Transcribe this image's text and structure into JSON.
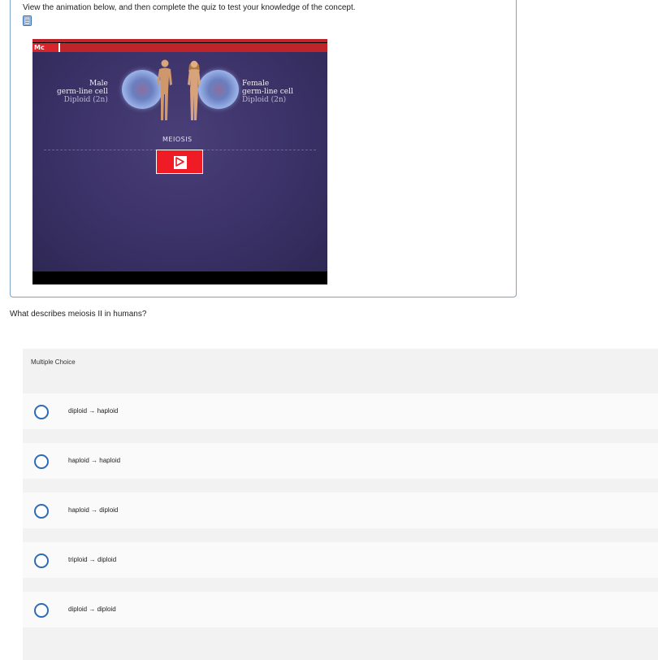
{
  "instruction": "View the animation below, and then complete the quiz to test your knowledge of the concept.",
  "video": {
    "logo_text": "Mc",
    "male_label": {
      "line1": "Male",
      "line2": "germ-line cell",
      "line3": "Diploid (2n)"
    },
    "female_label": {
      "line1": "Female",
      "line2": "germ-line cell",
      "line3": "Diploid (2n)"
    },
    "title": "MEIOSIS",
    "colors": {
      "brand_red": "#c0242b",
      "play_red": "#ef1c25",
      "frame": "#3b3268"
    }
  },
  "question": "What describes meiosis II in humans?",
  "multiple_choice": {
    "header": "Multiple Choice",
    "options": [
      "diploid → haploid",
      "haploid → haploid",
      "haploid → diploid",
      "triploid → diploid",
      "diploid → diploid"
    ]
  }
}
